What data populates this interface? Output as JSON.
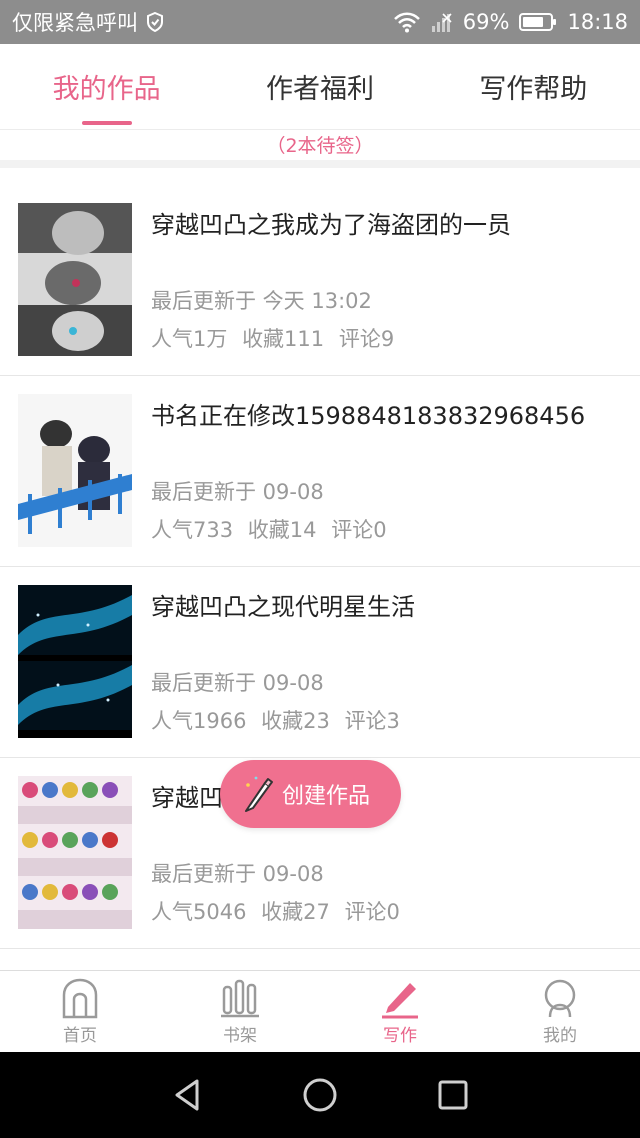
{
  "status_bar": {
    "left_text": "仅限紧急呼叫",
    "battery": "69%",
    "time": "18:18",
    "icons": [
      "shield-icon",
      "wifi-icon",
      "signal-icon",
      "battery-icon"
    ]
  },
  "tabs": [
    {
      "label": "我的作品",
      "active": true
    },
    {
      "label": "作者福利",
      "active": false
    },
    {
      "label": "写作帮助",
      "active": false
    }
  ],
  "pending": "（2本待签）",
  "works": [
    {
      "title": "穿越凹凸之我成为了海盗团的一员",
      "updated": "最后更新于 今天 13:02",
      "popularity": "人气1万",
      "favorites": "收藏111",
      "comments": "评论9"
    },
    {
      "title": "书名正在修改1598848183832968456",
      "updated": "最后更新于 09-08",
      "popularity": "人气733",
      "favorites": "收藏14",
      "comments": "评论0"
    },
    {
      "title": "穿越凹凸之现代明星生活",
      "updated": "最后更新于 09-08",
      "popularity": "人气1966",
      "favorites": "收藏23",
      "comments": "评论3"
    },
    {
      "title": "穿越凹凸之我…了",
      "updated": "最后更新于 09-08",
      "popularity": "人气5046",
      "favorites": "收藏27",
      "comments": "评论0"
    }
  ],
  "create_button": {
    "label": "创建作品",
    "icon": "pencil-icon"
  },
  "bottom_nav": [
    {
      "label": "首页",
      "icon": "home-icon",
      "active": false
    },
    {
      "label": "书架",
      "icon": "bookshelf-icon",
      "active": false
    },
    {
      "label": "写作",
      "icon": "pen-icon",
      "active": true
    },
    {
      "label": "我的",
      "icon": "profile-icon",
      "active": false
    }
  ],
  "colors": {
    "accent": "#e8658a",
    "button": "#f0708f",
    "muted": "#999999",
    "status_bar": "#8d8d8d"
  }
}
